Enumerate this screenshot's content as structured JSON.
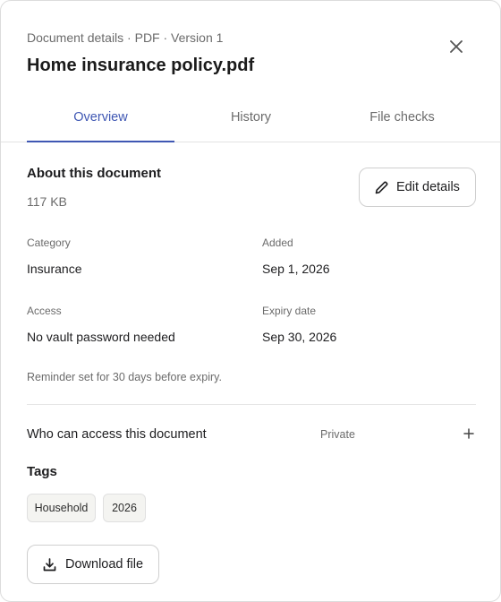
{
  "header": {
    "subtitle": "Document details · PDF · Version 1",
    "title": "Home insurance policy.pdf",
    "close_icon": "close-icon"
  },
  "tabs": [
    {
      "label": "Overview",
      "active": true
    },
    {
      "label": "History",
      "active": false
    },
    {
      "label": "File checks",
      "active": false
    }
  ],
  "about": {
    "heading": "About this document",
    "file_size": "117 KB",
    "edit_label": "Edit details",
    "edit_icon": "pencil-icon"
  },
  "fields": {
    "category": {
      "label": "Category",
      "value": "Insurance"
    },
    "added": {
      "label": "Added",
      "value": "Sep 1, 2026"
    },
    "access": {
      "label": "Access",
      "value": "No vault password needed"
    },
    "expiry": {
      "label": "Expiry date",
      "value": "Sep 30, 2026"
    }
  },
  "reminder": "Reminder set for 30 days before expiry.",
  "access_section": {
    "label": "Who can access this document",
    "state": "Private",
    "expand_icon": "plus-icon"
  },
  "tags": {
    "heading": "Tags",
    "items": [
      "Household",
      "2026"
    ]
  },
  "download": {
    "label": "Download file",
    "icon": "download-icon"
  },
  "colors": {
    "accent": "#3f57b3",
    "text": "#1d1d1f",
    "muted": "#6b6b6b",
    "tag_bg": "#f4f4f1"
  }
}
